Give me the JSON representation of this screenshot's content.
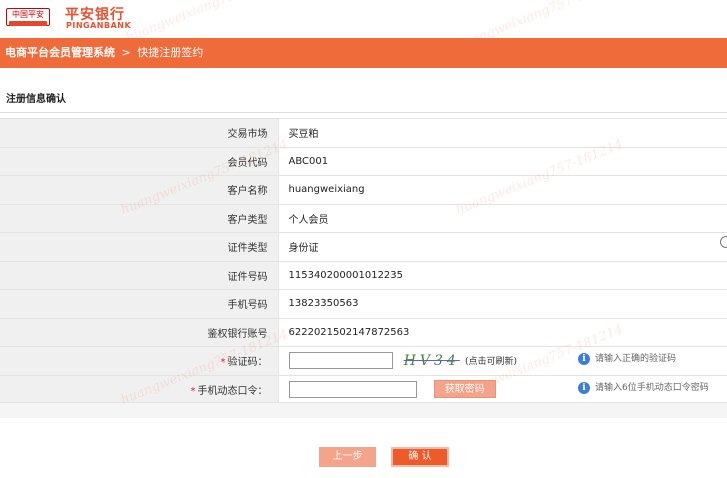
{
  "header": {
    "logo_small": "中国平安",
    "logo_cn": "平安银行",
    "logo_en": "PINGANBANK"
  },
  "navbar": {
    "system": "电商平台会员管理系统",
    "separator": ">",
    "page": "快捷注册签约"
  },
  "section_title": "注册信息确认",
  "rows": [
    {
      "label": "交易市场",
      "value": "买豆粕"
    },
    {
      "label": "会员代码",
      "value": "ABC001"
    },
    {
      "label": "客户名称",
      "value": "huangweixiang"
    },
    {
      "label": "客户类型",
      "value": "个人会员"
    },
    {
      "label": "证件类型",
      "value": "身份证"
    },
    {
      "label": "证件号码",
      "value": "115340200001012235"
    },
    {
      "label": "手机号码",
      "value": "13823350563"
    },
    {
      "label": "鉴权银行账号",
      "value": "6222021502147872563"
    }
  ],
  "captcha": {
    "required_mark": "*",
    "label": "验证码：",
    "value": "",
    "image_text": "HV34",
    "refresh_hint": "(点击可刷新)",
    "tip": "请输入正确的验证码"
  },
  "otp": {
    "required_mark": "*",
    "label": "手机动态口令：",
    "value": "",
    "button": "获取密码",
    "tip": "请输入6位手机动态口令密码"
  },
  "buttons": {
    "prev": "上一步",
    "confirm": "确 认"
  },
  "watermark": "huangweixiang757-181214",
  "icons": {
    "tip": "info-icon",
    "radio": "radio-circle"
  },
  "colors": {
    "brand": "#f06b3a",
    "confirm": "#ee5a28",
    "disabled_button": "#f4a48a",
    "required": "#e02020",
    "info_icon": "#3b7fd4"
  }
}
